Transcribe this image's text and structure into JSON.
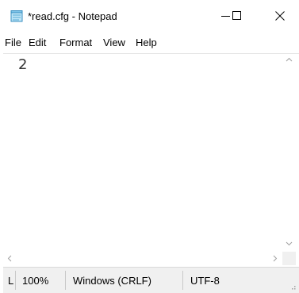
{
  "window": {
    "title": "*read.cfg - Notepad",
    "icon": "notepad-icon",
    "controls": [
      "minimize-icon",
      "maximize-icon",
      "close-icon"
    ]
  },
  "menu": {
    "items": [
      "File",
      "Edit",
      "Format",
      "View",
      "Help"
    ]
  },
  "editor": {
    "content": "2"
  },
  "status": {
    "position": "L",
    "zoom": "100%",
    "line_ending": "Windows (CRLF)",
    "encoding": "UTF-8"
  },
  "colors": {
    "background": "#ffffff",
    "statusbar": "#f0f0f0",
    "arrow": "#a0a0a0"
  }
}
